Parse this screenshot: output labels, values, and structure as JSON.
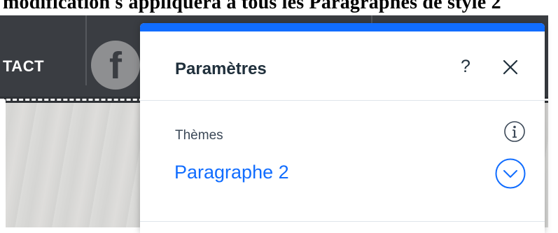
{
  "top_text": "modification s'appliquera à tous les Paragraphes de style 2",
  "site": {
    "nav_contact": "TACT",
    "facebook_glyph": "f"
  },
  "panel": {
    "title": "Paramètres",
    "help_label": "?",
    "close_icon": "close-icon",
    "section_label": "Thèmes",
    "theme_value": "Paragraphe 2",
    "info_icon": "info-icon",
    "dropdown_icon": "chevron-down-icon",
    "accent_color": "#116dff"
  }
}
